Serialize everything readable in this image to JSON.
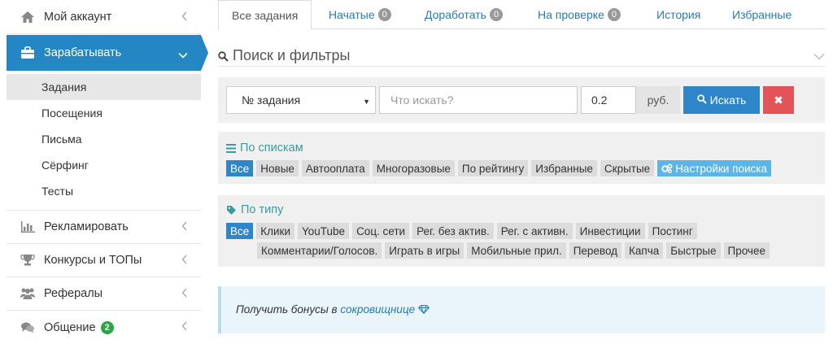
{
  "sidebar": {
    "items": [
      {
        "label": "Мой аккаунт",
        "icon": "home-icon"
      },
      {
        "label": "Зарабатывать",
        "icon": "briefcase-icon"
      },
      {
        "label": "Рекламировать",
        "icon": "bar-chart-icon"
      },
      {
        "label": "Конкурсы и ТОПы",
        "icon": "trophy-icon"
      },
      {
        "label": "Рефералы",
        "icon": "users-icon"
      },
      {
        "label": "Общение",
        "icon": "comments-icon",
        "badge": "2"
      }
    ],
    "submenu": [
      "Задания",
      "Посещения",
      "Письма",
      "Сёрфинг",
      "Тесты"
    ]
  },
  "tabs": [
    {
      "label": "Все задания"
    },
    {
      "label": "Начатые",
      "badge": "0"
    },
    {
      "label": "Доработать",
      "badge": "0"
    },
    {
      "label": "На проверке",
      "badge": "0"
    },
    {
      "label": "История"
    },
    {
      "label": "Избранные"
    }
  ],
  "search": {
    "title": "Поиск и фильтры",
    "select_value": "№ задания",
    "query_placeholder": "Что искать?",
    "amount_value": "0.2",
    "currency": "руб.",
    "search_button": "Искать",
    "clear_button": "✖"
  },
  "lists": {
    "title": "По спискам",
    "tags": [
      "Все",
      "Новые",
      "Автооплата",
      "Многоразовые",
      "По рейтингу",
      "Избранные",
      "Скрытые"
    ],
    "settings": "Настройки поиска"
  },
  "types": {
    "title": "По типу",
    "row1": [
      "Все",
      "Клики",
      "YouTube",
      "Соц. сети",
      "Рег. без актив.",
      "Рег. с активн.",
      "Инвестиции",
      "Постинг"
    ],
    "row2": [
      "Комментарии/Голосов.",
      "Играть в игры",
      "Мобильные прил.",
      "Перевод",
      "Капча",
      "Быстрые",
      "Прочее"
    ]
  },
  "bonus": {
    "text": "Получить бонусы в ",
    "link": "сокровищнице"
  },
  "colors": {
    "accent": "#2586c4",
    "active_tag": "#2e86c9",
    "settings_tag": "#5bb5e9",
    "danger": "#e25458",
    "title_teal": "#3a9c9b",
    "badge_green": "#2aa744"
  }
}
